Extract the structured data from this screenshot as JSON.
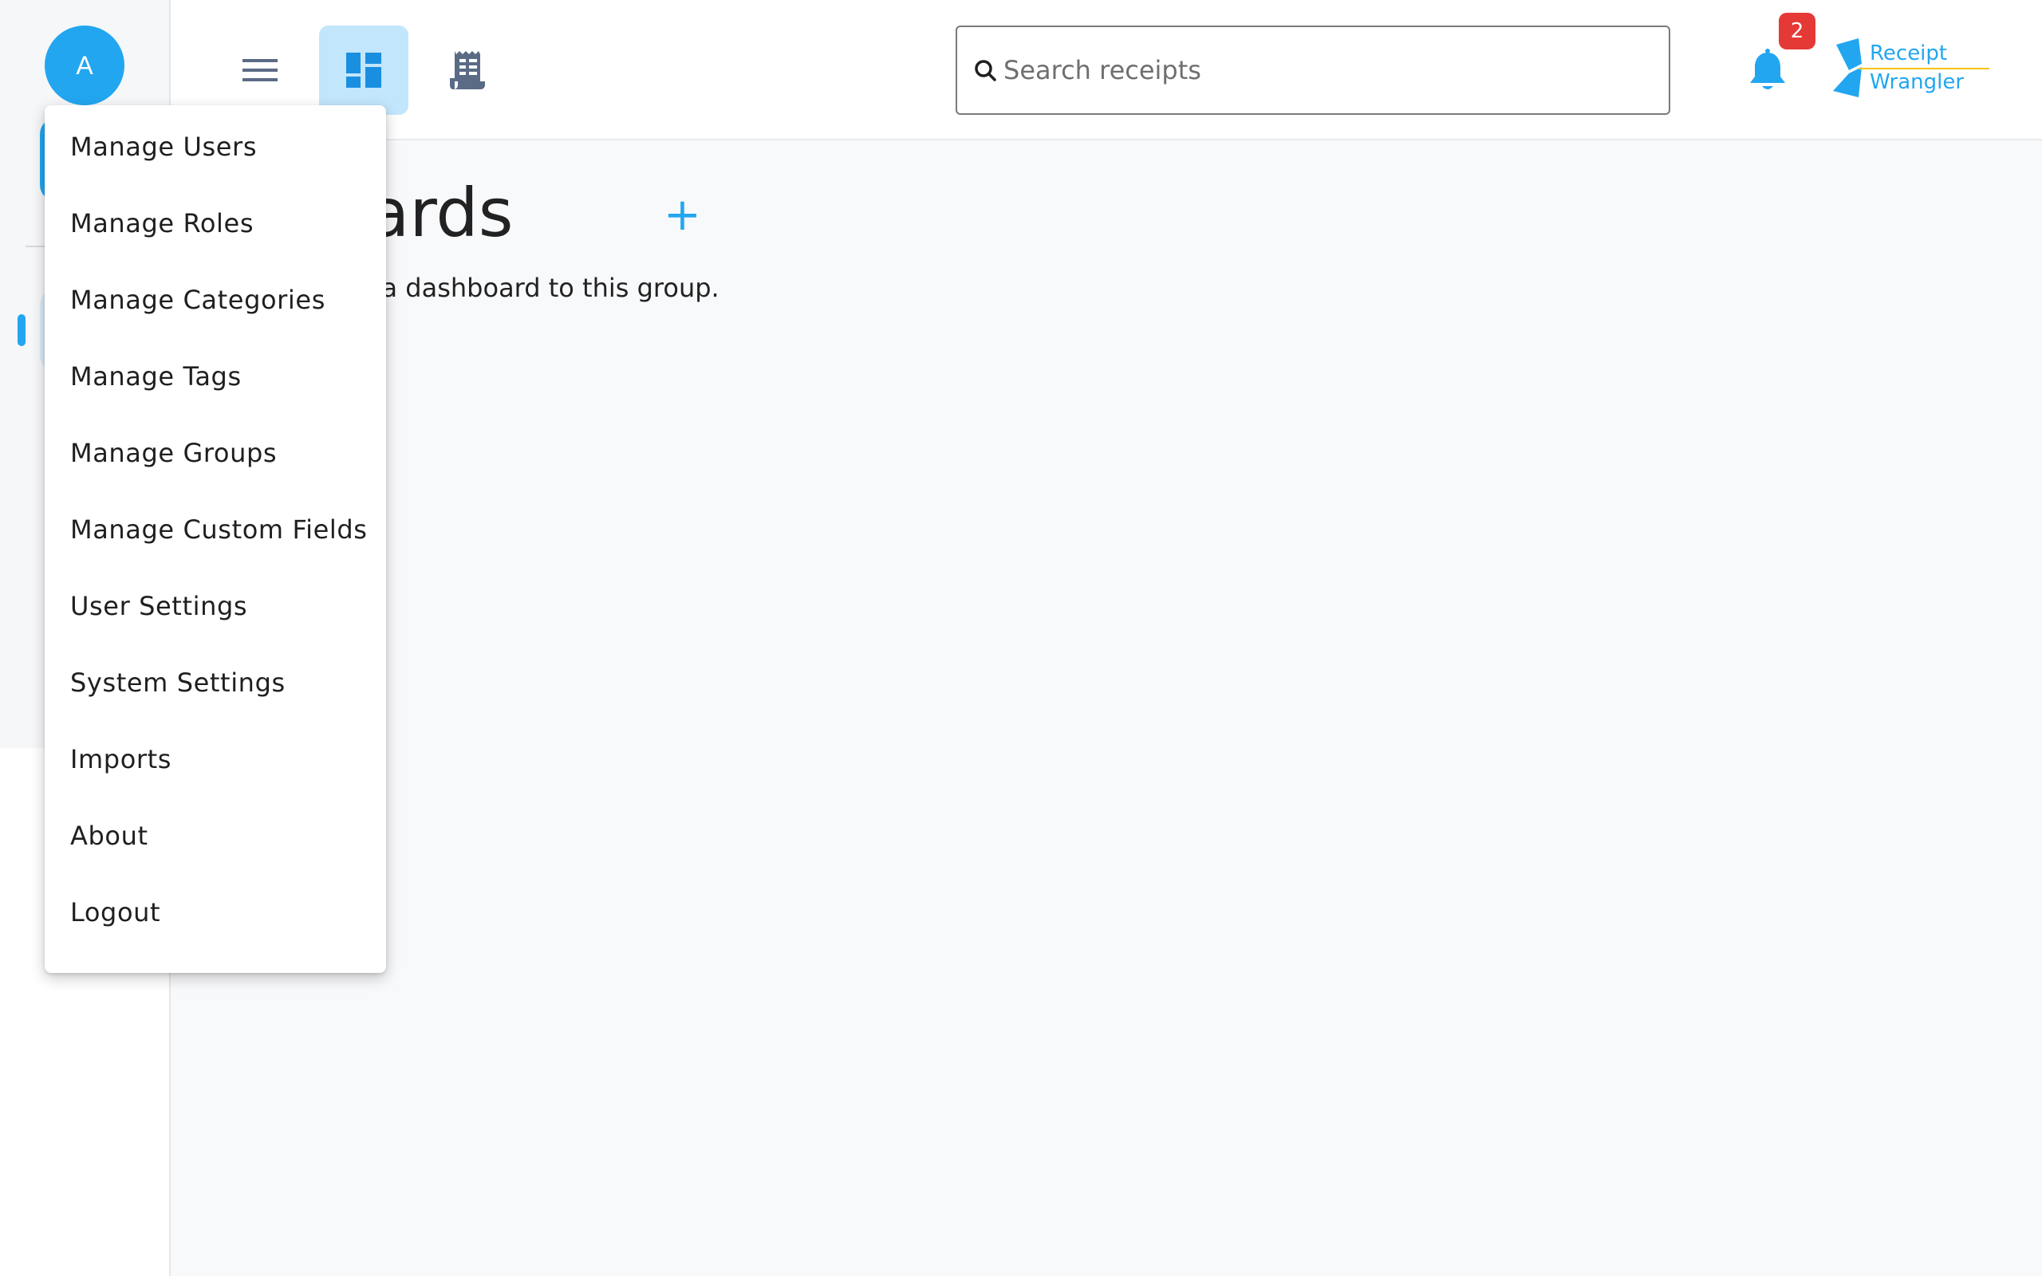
{
  "user": {
    "avatar_initial": "A"
  },
  "topbar": {
    "search_placeholder": "Search receipts",
    "notification_count": "2",
    "logo_line1": "Receipt",
    "logo_line2": "Wrangler"
  },
  "main": {
    "title": "Dashboards",
    "add_symbol": "+",
    "hint": "Click the + button to add a dashboard to this group."
  },
  "menu": {
    "items": [
      "Manage Users",
      "Manage Roles",
      "Manage Categories",
      "Manage Tags",
      "Manage Groups",
      "Manage Custom Fields",
      "User Settings",
      "System Settings",
      "Imports",
      "About",
      "Logout"
    ]
  },
  "colors": {
    "accent": "#23a6f0",
    "active_bg": "#c2e6fb",
    "badge": "#e53935",
    "logo_line": "#f5c518"
  },
  "icons": {
    "menu_toggle": "menu-icon",
    "dashboard": "dashboard-icon",
    "receipts": "receipt-icon",
    "notifications": "bell-icon",
    "search": "search-icon"
  }
}
